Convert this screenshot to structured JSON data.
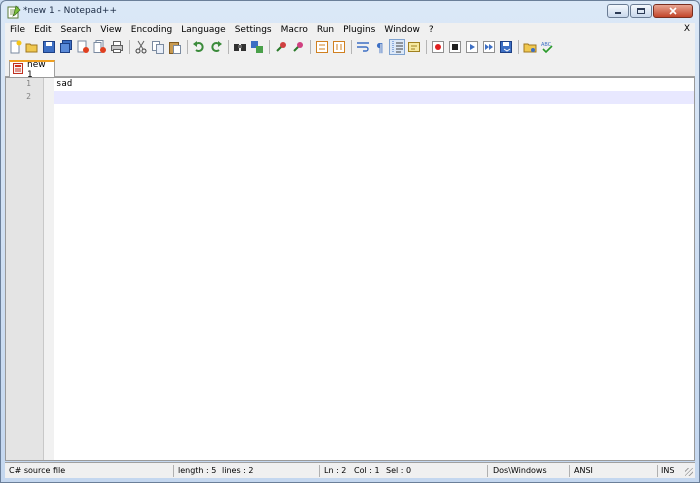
{
  "window": {
    "title": "*new 1 - Notepad++"
  },
  "menu": {
    "items": [
      "File",
      "Edit",
      "Search",
      "View",
      "Encoding",
      "Language",
      "Settings",
      "Macro",
      "Run",
      "Plugins",
      "Window",
      "?"
    ],
    "close_label": "X"
  },
  "toolbar": {
    "icons": [
      "new-file-icon",
      "open-file-icon",
      "save-icon",
      "save-all-icon",
      "close-icon",
      "close-all-icon",
      "print-icon",
      "cut-icon",
      "copy-icon",
      "paste-icon",
      "undo-icon",
      "redo-icon",
      "find-icon",
      "replace-icon",
      "zoom-in-icon",
      "zoom-out-icon",
      "sync-vertical-icon",
      "sync-horizontal-icon",
      "word-wrap-icon",
      "show-all-characters-icon",
      "indent-guide-icon",
      "user-defined-language-icon",
      "record-macro-icon",
      "stop-recording-icon",
      "play-macro-icon",
      "run-macro-multiple-icon",
      "save-macro-icon",
      "open-folder-icon",
      "spell-check-icon"
    ],
    "active_icon": "indent-guide-icon"
  },
  "tabs": [
    {
      "label": "new  1",
      "modified": true
    }
  ],
  "editor": {
    "lines": [
      {
        "number": "1",
        "text": "sad"
      },
      {
        "number": "2",
        "text": ""
      }
    ],
    "current_line": 2,
    "highlight_color": "#e8e8ff"
  },
  "status": {
    "file_type": "C# source file",
    "length": "length : 5",
    "lines": "lines : 2",
    "ln": "Ln : 2",
    "col": "Col : 1",
    "sel": "Sel : 0",
    "eol": "Dos\\Windows",
    "encoding": "ANSI",
    "mode": "INS"
  }
}
